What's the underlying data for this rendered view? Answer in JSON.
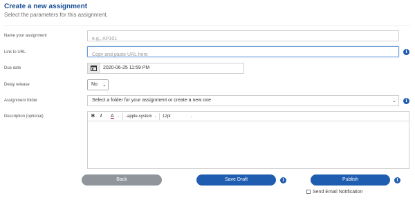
{
  "page": {
    "title": "Create a new assignment",
    "subtitle": "Select the parameters for this assignment."
  },
  "form": {
    "name": {
      "label": "Name your assignment",
      "placeholder": "e.g., AP101",
      "value": ""
    },
    "url": {
      "label": "Link to URL",
      "placeholder": "Copy and paste URL here",
      "value": ""
    },
    "due": {
      "label": "Due date",
      "value": "2020-06-25 11:59 PM"
    },
    "delay": {
      "label": "Delay release",
      "value": "No"
    },
    "folder": {
      "label": "Assignment folder",
      "value": "Select a folder for your assignment or create a new one"
    },
    "description": {
      "label": "Description (optional)",
      "toolbar": {
        "bold": "B",
        "italic": "I",
        "color": "A",
        "font": "-apple-system",
        "size": "12pt"
      }
    }
  },
  "actions": {
    "back": "Back",
    "save_draft": "Save Draft",
    "publish": "Publish",
    "notify_label": "Send Email Notification"
  },
  "icons": {
    "info": "info-icon",
    "calendar": "calendar-icon",
    "dropdown": "chevron-down-icon"
  },
  "colors": {
    "primary": "#1e5db0",
    "secondary": "#8f959a",
    "title": "#1a4e96"
  }
}
